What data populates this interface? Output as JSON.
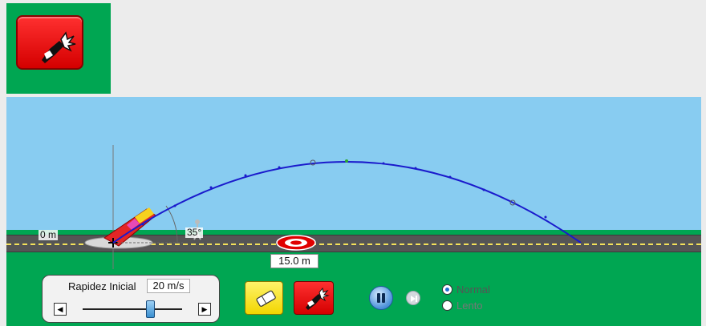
{
  "toolbar_icon": {
    "name": "cannon-fire-icon",
    "color": "#e00000"
  },
  "scene": {
    "ground_label": "0 m",
    "angle_label": "35°",
    "target_distance": "15.0 m"
  },
  "speed_panel": {
    "title": "Rapidez Inicial",
    "value": "20 m/s",
    "slider_fraction": 0.68
  },
  "buttons": {
    "erase_icon": "eraser-icon",
    "fire_icon": "cannon-fire-icon",
    "pause_icon": "pause-icon",
    "step_icon": "step-forward-icon"
  },
  "speed_mode": {
    "options": [
      "Normal",
      "Lento"
    ],
    "selected": "Normal"
  },
  "colors": {
    "sky": "#88ccf1",
    "grass": "#00a652",
    "trajectory": "#1a1acc",
    "fire_button": "#e00000",
    "erase_button": "#f7e21b"
  }
}
